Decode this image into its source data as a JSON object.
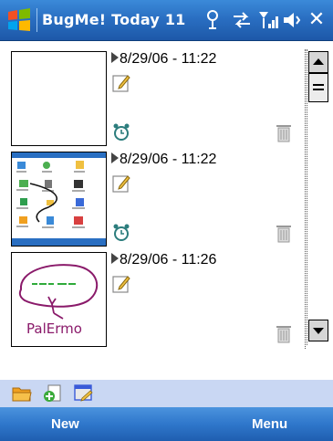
{
  "titlebar": {
    "app_title": "BugMe! Today 11",
    "icons": [
      "windows-start-icon",
      "connectivity-icon",
      "data-sync-icon",
      "signal-strength-icon",
      "volume-icon",
      "close-icon"
    ],
    "close_label": "✕"
  },
  "notes": [
    {
      "datetime": "8/29/06 - 11:22",
      "thumbnail": "blank",
      "has_alarm": true
    },
    {
      "datetime": "8/29/06 - 11:22",
      "thumbnail": "desktop-screenshot",
      "has_alarm": true
    },
    {
      "datetime": "8/29/06 - 11:26",
      "thumbnail": "handwritten-sketch",
      "has_alarm": false,
      "sketch_text": "PalErmo"
    }
  ],
  "toolbar": {
    "icons": [
      "open-folder-icon",
      "new-note-icon",
      "settings-icon"
    ]
  },
  "softkeys": {
    "left": "New",
    "right": "Menu"
  },
  "colors": {
    "titlebar_blue": "#2a6fc2",
    "softkey_blue": "#2f77cb",
    "toolbar_bg": "#c9d7f3"
  }
}
